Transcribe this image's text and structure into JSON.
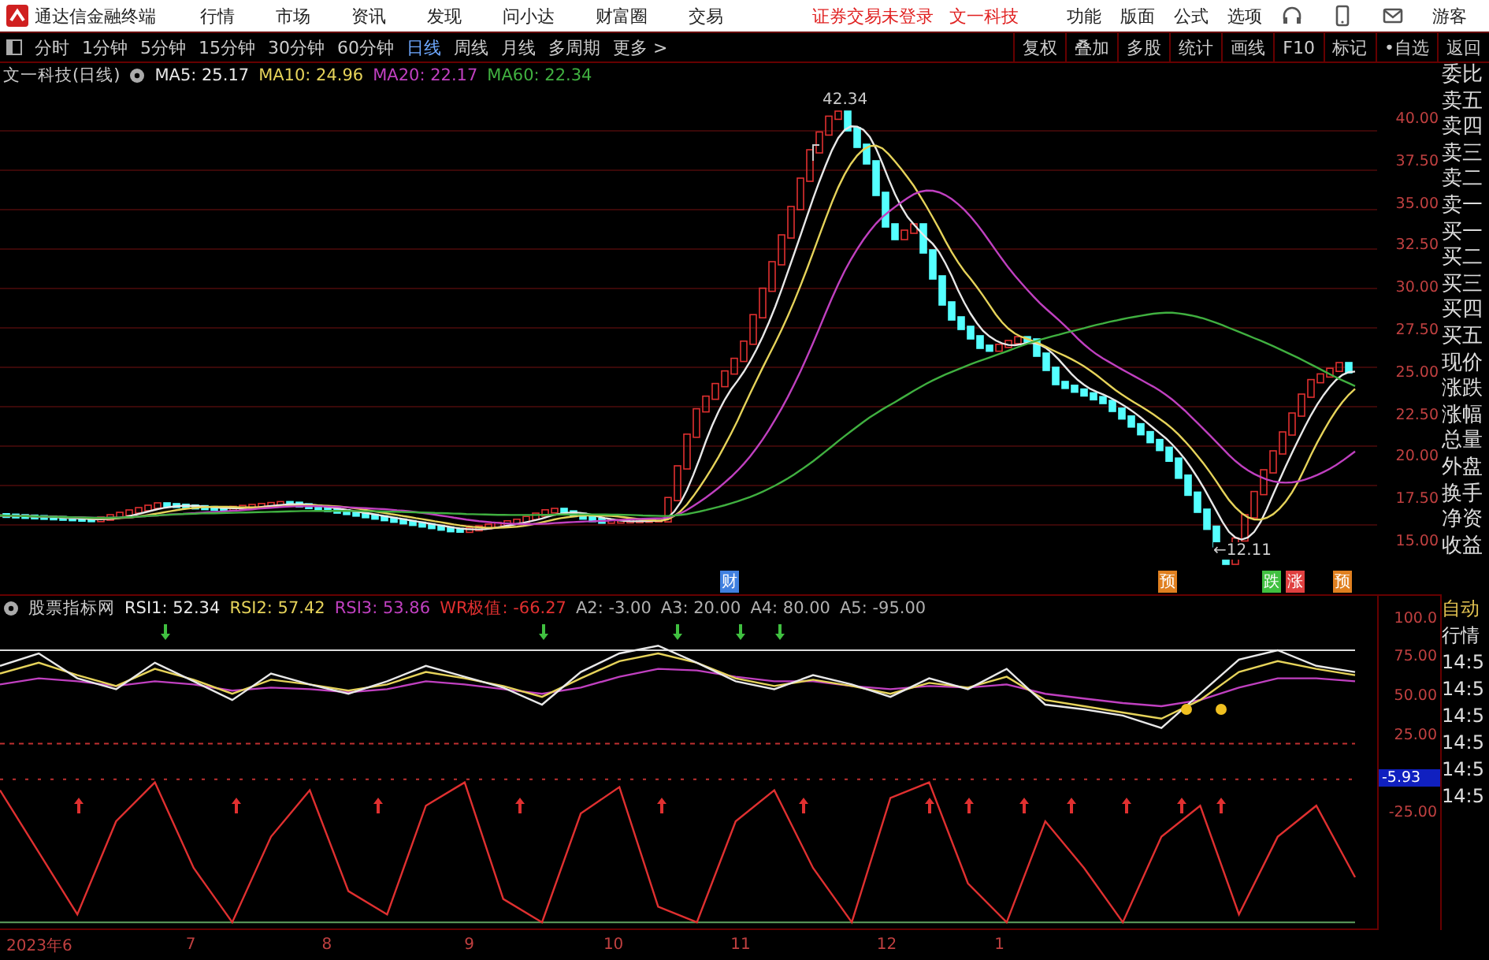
{
  "title_bar": {
    "app_name": "通达信金融终端",
    "menu": [
      "行情",
      "市场",
      "资讯",
      "发现",
      "问小达",
      "财富圈",
      "交易"
    ],
    "status": "证券交易未登录",
    "stock": "文一科技",
    "right_menu": [
      "功能",
      "版面",
      "公式",
      "选项"
    ],
    "user": "游客"
  },
  "toolbar": {
    "periods": [
      {
        "label": "分时",
        "selected": false
      },
      {
        "label": "1分钟",
        "selected": false
      },
      {
        "label": "5分钟",
        "selected": false
      },
      {
        "label": "15分钟",
        "selected": false
      },
      {
        "label": "30分钟",
        "selected": false
      },
      {
        "label": "60分钟",
        "selected": false
      },
      {
        "label": "日线",
        "selected": true
      },
      {
        "label": "周线",
        "selected": false
      },
      {
        "label": "月线",
        "selected": false
      },
      {
        "label": "多周期",
        "selected": false
      },
      {
        "label": "更多 >",
        "selected": false
      }
    ],
    "actions": [
      "复权",
      "叠加",
      "多股",
      "统计",
      "画线",
      "F10",
      "标记",
      "•自选",
      "返回"
    ]
  },
  "price_pane": {
    "title": "文一科技(日线)",
    "legend": [
      {
        "label": "MA5: 25.17",
        "color": "#e8e8e8"
      },
      {
        "label": "MA10: 24.96",
        "color": "#e6d35a"
      },
      {
        "label": "MA20: 22.17",
        "color": "#c040c0"
      },
      {
        "label": "MA60: 22.34",
        "color": "#40b040"
      }
    ],
    "high_label": "42.34",
    "low_label": "←12.11",
    "axis": [
      "40.00",
      "37.50",
      "35.00",
      "32.50",
      "30.00",
      "27.50",
      "25.00",
      "22.50",
      "20.00",
      "17.50",
      "15.00"
    ],
    "markers": [
      {
        "text": "财",
        "color": "#4080e0"
      },
      {
        "text": "预",
        "color": "#e08020"
      },
      {
        "text": "跌",
        "color": "#40c040"
      },
      {
        "text": "涨",
        "color": "#e04040"
      },
      {
        "text": "预",
        "color": "#e08020"
      }
    ]
  },
  "indicator_pane": {
    "title": "股票指标网",
    "chart_data": {
      "type": "line",
      "ylim": [
        -100,
        115
      ],
      "yticks": [
        {
          "value": 100,
          "label": "100.0"
        },
        {
          "value": 75,
          "label": "75.00"
        },
        {
          "value": 50,
          "label": "50.00"
        },
        {
          "value": 25,
          "label": "25.00"
        },
        {
          "value": -25,
          "label": "-25.00"
        }
      ],
      "series": [
        {
          "name": "RSI1",
          "color": "#e8e8e8",
          "values": [
            70,
            78,
            62,
            55,
            72,
            60,
            48,
            65,
            58,
            52,
            60,
            70,
            63,
            56,
            45,
            66,
            78,
            83,
            72,
            60,
            55,
            64,
            58,
            50,
            62,
            55,
            68,
            45,
            42,
            38,
            30,
            52,
            74,
            80,
            70,
            66
          ]
        },
        {
          "name": "RSI2",
          "color": "#e6d35a",
          "values": [
            65,
            72,
            64,
            57,
            68,
            61,
            52,
            61,
            58,
            54,
            58,
            66,
            62,
            57,
            50,
            62,
            73,
            78,
            72,
            62,
            57,
            61,
            57,
            52,
            59,
            56,
            63,
            48,
            44,
            40,
            36,
            48,
            66,
            73,
            68,
            64
          ]
        },
        {
          "name": "RSI3",
          "color": "#c040c0",
          "values": [
            58,
            62,
            60,
            57,
            60,
            58,
            54,
            56,
            55,
            53,
            55,
            60,
            58,
            55,
            52,
            56,
            63,
            68,
            67,
            63,
            60,
            60,
            57,
            55,
            57,
            56,
            58,
            52,
            49,
            46,
            44,
            48,
            56,
            62,
            62,
            60
          ]
        },
        {
          "name": "WR极值",
          "color": "#e03030",
          "values": [
            -10,
            -50,
            -90,
            -30,
            -5,
            -60,
            -95,
            -40,
            -10,
            -75,
            -90,
            -20,
            -5,
            -80,
            -95,
            -25,
            -8,
            -85,
            -95,
            -30,
            -10,
            -60,
            -95,
            -15,
            -5,
            -70,
            -95,
            -30,
            -60,
            -95,
            -40,
            -20,
            -90,
            -40,
            -20,
            -66
          ]
        },
        {
          "name": "A2",
          "color": "#c03030",
          "line_style": "dotted",
          "values": [
            -3,
            -3,
            -3,
            -3,
            -3,
            -3,
            -3,
            -3,
            -3,
            -3,
            -3,
            -3,
            -3,
            -3,
            -3,
            -3,
            -3,
            -3,
            -3,
            -3,
            -3,
            -3,
            -3,
            -3,
            -3,
            -3,
            -3,
            -3,
            -3,
            -3,
            -3,
            -3,
            -3,
            -3,
            -3,
            -3
          ]
        },
        {
          "name": "A3",
          "color": "#c03030",
          "line_style": "dashed",
          "values": [
            20,
            20,
            20,
            20,
            20,
            20,
            20,
            20,
            20,
            20,
            20,
            20,
            20,
            20,
            20,
            20,
            20,
            20,
            20,
            20,
            20,
            20,
            20,
            20,
            20,
            20,
            20,
            20,
            20,
            20,
            20,
            20,
            20,
            20,
            20,
            20
          ]
        },
        {
          "name": "A4",
          "color": "#dddddd",
          "values": [
            80,
            80,
            80,
            80,
            80,
            80,
            80,
            80,
            80,
            80,
            80,
            80,
            80,
            80,
            80,
            80,
            80,
            80,
            80,
            80,
            80,
            80,
            80,
            80,
            80,
            80,
            80,
            80,
            80,
            80,
            80,
            80,
            80,
            80,
            80,
            80
          ]
        },
        {
          "name": "A5",
          "color": "#60a060",
          "values": [
            -95,
            -95,
            -95,
            -95,
            -95,
            -95,
            -95,
            -95,
            -95,
            -95,
            -95,
            -95,
            -95,
            -95,
            -95,
            -95,
            -95,
            -95,
            -95,
            -95,
            -95,
            -95,
            -95,
            -95,
            -95,
            -95,
            -95,
            -95,
            -95,
            -95,
            -95,
            -95,
            -95,
            -95,
            -95,
            -95
          ]
        }
      ]
    },
    "series_values": [
      ": 52.34",
      ": 57.42",
      ": 53.86",
      ": -66.27",
      ": -3.00",
      ": 20.00",
      ": 80.00",
      ": -95.00"
    ],
    "current_value": "-5.93"
  },
  "time_axis": [
    "2023年6",
    "7",
    "8",
    "9",
    "10",
    "11",
    "12",
    "1"
  ],
  "side_panel": {
    "quote_labels": [
      "委比",
      "卖五",
      "卖四",
      "卖三",
      "卖二",
      "卖一",
      "买一",
      "买二",
      "买三",
      "买四",
      "买五",
      "现价",
      "涨跌",
      "涨幅",
      "总量",
      "外盘",
      "换手",
      "净资",
      "收益"
    ],
    "auto_label": "自动",
    "market_label": "行情",
    "times": [
      "14:5",
      "14:5",
      "14:5",
      "14:5",
      "14:5",
      "14:5"
    ]
  }
}
